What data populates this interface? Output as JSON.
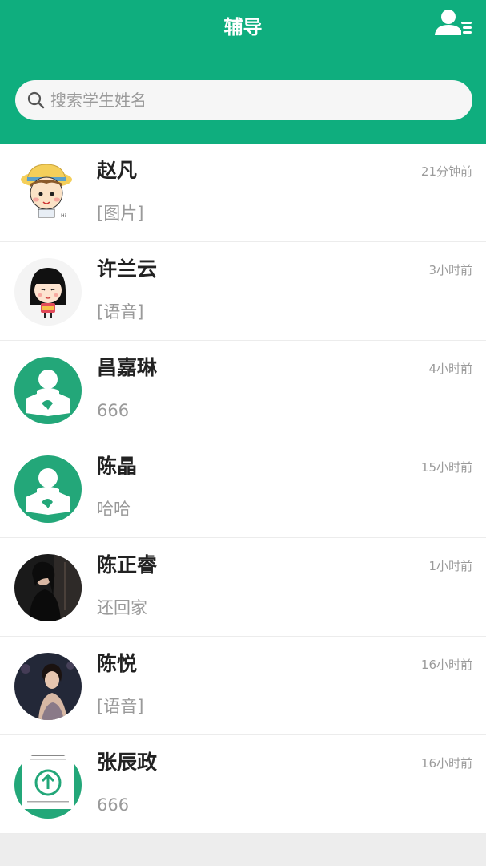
{
  "header": {
    "title": "辅导",
    "accent_color": "#0fae7e",
    "menu_icon": "user-list-icon"
  },
  "search": {
    "placeholder": "搜索学生姓名",
    "value": "",
    "icon": "search-icon"
  },
  "students": [
    {
      "name": "赵凡",
      "time": "21分钟前",
      "message": "[图片]",
      "avatar": "cartoon-boy-hat"
    },
    {
      "name": "许兰云",
      "time": "3小时前",
      "message": "[语音]",
      "avatar": "cartoon-girl"
    },
    {
      "name": "昌嘉琳",
      "time": "4小时前",
      "message": "666",
      "avatar": "default-green"
    },
    {
      "name": "陈晶",
      "time": "15小时前",
      "message": "哈哈",
      "avatar": "default-green"
    },
    {
      "name": "陈正睿",
      "time": "1小时前",
      "message": "还回家",
      "avatar": "photo-dark"
    },
    {
      "name": "陈悦",
      "time": "16小时前",
      "message": "[语音]",
      "avatar": "photo-portrait"
    },
    {
      "name": "张辰政",
      "time": "16小时前",
      "message": "666",
      "avatar": "green-arrow-logo"
    }
  ]
}
